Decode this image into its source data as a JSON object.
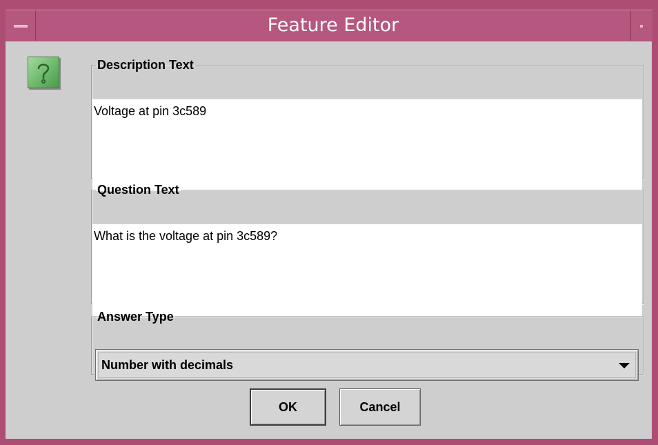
{
  "window": {
    "title": "Feature Editor"
  },
  "icons": {
    "dialog_icon": "question-icon",
    "menu_icon": "window-menu-icon",
    "minimize_icon": "minimize-icon"
  },
  "description": {
    "legend": "Description Text",
    "value": "Voltage at pin 3c589"
  },
  "question": {
    "legend": "Question Text",
    "value": "What is the voltage at pin 3c589?"
  },
  "answer_type": {
    "legend": "Answer Type",
    "selected": "Number with decimals"
  },
  "buttons": {
    "ok": "OK",
    "cancel": "Cancel"
  },
  "colors": {
    "titlebar": "#b5577e",
    "window_border": "#ae4d74",
    "dialog_background": "#cecece",
    "icon_green": "#6cb96a"
  }
}
